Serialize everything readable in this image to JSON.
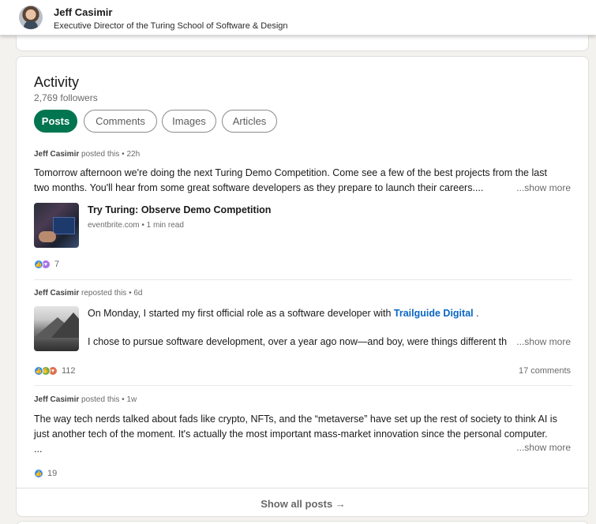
{
  "header": {
    "name": "Jeff Casimir",
    "headline": "Executive Director of the Turing School of Software & Design"
  },
  "activity": {
    "title": "Activity",
    "followers": "2,769 followers",
    "tabs": [
      {
        "label": "Posts",
        "active": true
      },
      {
        "label": "Comments",
        "active": false
      },
      {
        "label": "Images",
        "active": false
      },
      {
        "label": "Articles",
        "active": false
      }
    ],
    "posts": [
      {
        "author": "Jeff Casimir",
        "action": " posted this • 22h",
        "line1": "Tomorrow afternoon we're doing the next Turing Demo Competition. Come see a few of the best projects from the last",
        "line2": "two months. You'll hear from some great software developers as they prepare to launch their careers....",
        "show_more": "...show more",
        "link_title": "Try Turing: Observe Demo Competition",
        "link_sub": "eventbrite.com • 1 min read",
        "reaction_count": "7",
        "reactions": [
          "like-icon",
          "support-icon"
        ]
      },
      {
        "author": "Jeff Casimir",
        "action": " reposted this • 6d",
        "line1_prefix": "On Monday, I started my first official role as a software developer with ",
        "line1_link": "Trailguide Digital",
        "line1_suffix": " .",
        "line2": "I chose to pursue software development, over a year ago now—and boy, were things different th",
        "show_more": "...show more",
        "reaction_count": "112",
        "comments": "17 comments",
        "reactions": [
          "like-icon",
          "celebrate-icon",
          "love-icon"
        ]
      },
      {
        "author": "Jeff Casimir",
        "action": " posted this • 1w",
        "line1": "The way tech nerds talked about fads like crypto, NFTs, and the “metaverse” have set up the rest of society to think AI is",
        "line2": "just another tech of the moment. It's actually the most important mass-market innovation since the personal computer.",
        "line3": "...",
        "show_more": "...show more",
        "reaction_count": "19",
        "reactions": [
          "like-icon"
        ]
      }
    ],
    "show_all": "Show all posts →"
  },
  "colors": {
    "accent_green": "#01754f",
    "link_blue": "#0a66c2",
    "like_blue": "#378fe9"
  }
}
